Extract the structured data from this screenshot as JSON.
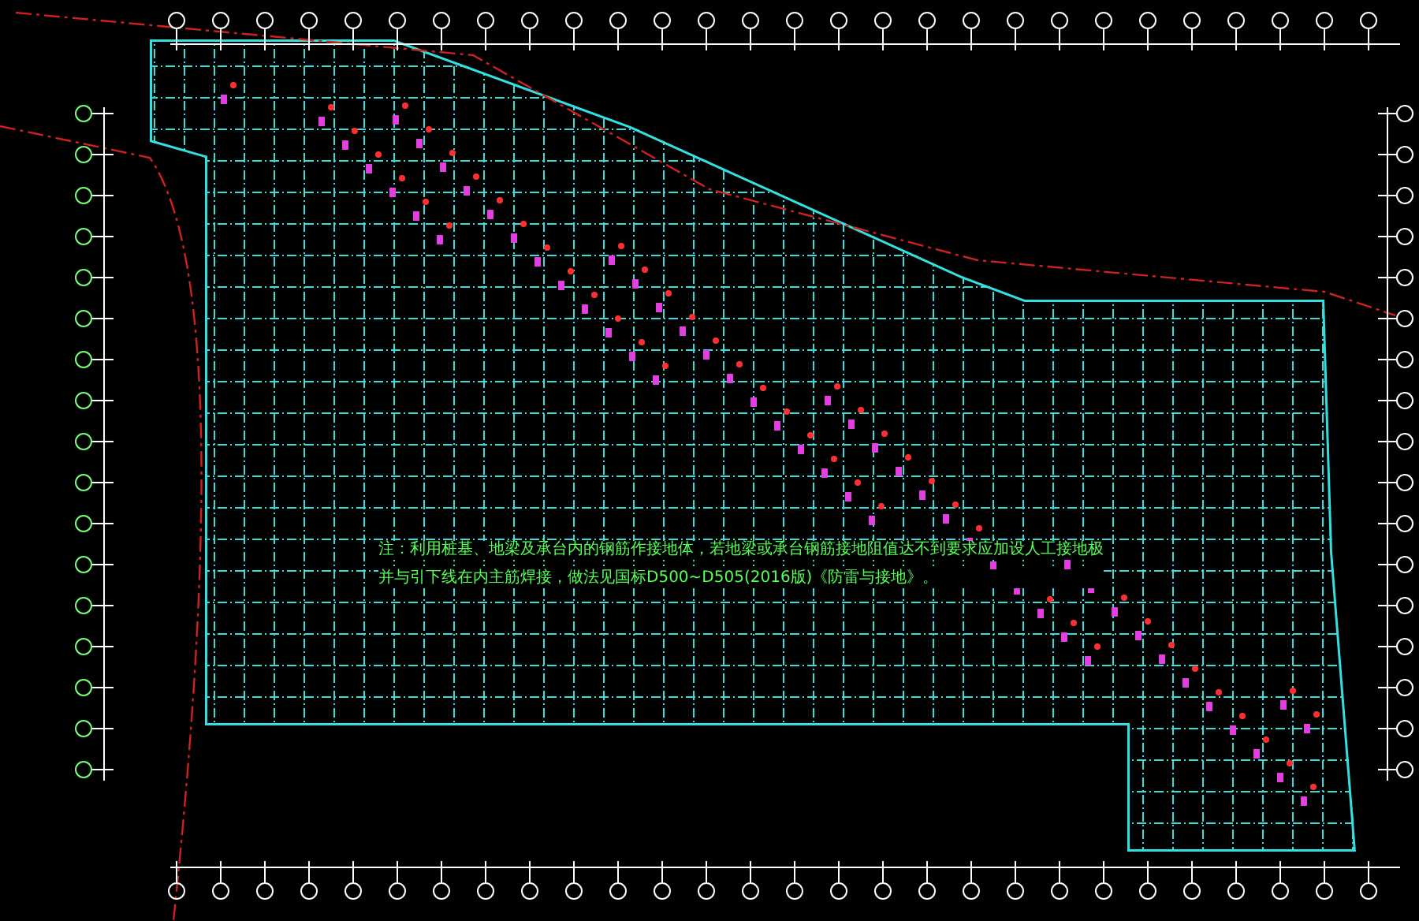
{
  "drawing": {
    "note_lines": [
      "注：利用桩基、地梁及承台内的钢筋作接地体，若地梁或承台钢筋接地阻值达不到要求应加设人工接地极",
      "并与引下线在内主筋焊接，做法见国标D500~D505(2016版)《防雷与接地》。"
    ]
  }
}
